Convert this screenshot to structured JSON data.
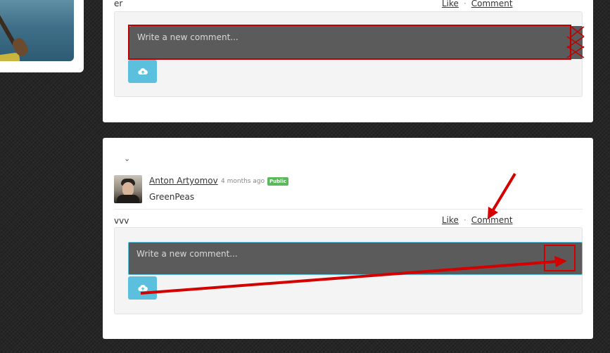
{
  "comments_section_1": {
    "truncated_text": "er",
    "like_label": "Like",
    "comment_label": "Comment",
    "input_placeholder": "Write a new comment..."
  },
  "post": {
    "author_name": "Anton Artyomov",
    "timestamp": "4 months ago",
    "visibility_badge": "Public",
    "body": "GreenPeas",
    "chevron_glyph": "⌄",
    "reply_text": "vvv",
    "like_label": "Like",
    "comment_label": "Comment",
    "input_placeholder": "Write a new comment..."
  },
  "icons": {
    "upload": "upload-cloud-icon",
    "chevron": "chevron-down-icon"
  },
  "colors": {
    "page_bg": "#262626",
    "input_bg": "#5b5b5b",
    "upload_button": "#5bc0de",
    "public_badge": "#5cb85c",
    "annotation_red": "#d40000"
  }
}
